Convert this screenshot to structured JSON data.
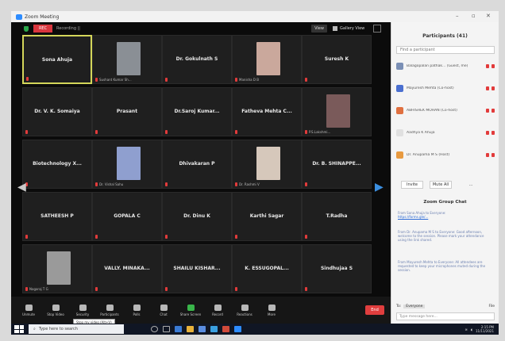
{
  "window": {
    "title": "Zoom Meeting"
  },
  "meeting_bar": {
    "rec_label": "REC",
    "recording_text": "Recording ||",
    "view_label": "View",
    "gallery_label": "Gallery View"
  },
  "tiles": [
    {
      "name": "Sona Ahuja",
      "sub": "",
      "has_photo": false,
      "active": true
    },
    {
      "name": "",
      "sub": "Sushant Kumar Sh...",
      "has_photo": true,
      "photo_color": "#8a8f95",
      "active": false
    },
    {
      "name": "Dr. Gokulnath S",
      "sub": "",
      "has_photo": false,
      "active": false
    },
    {
      "name": "",
      "sub": "Manisha D B",
      "has_photo": true,
      "photo_color": "#caa89c",
      "active": false
    },
    {
      "name": "Suresh K",
      "sub": "",
      "has_photo": false,
      "active": false
    },
    {
      "name": "Dr. V. K. Somaiya",
      "sub": "",
      "has_photo": false,
      "active": false
    },
    {
      "name": "Prasant",
      "sub": "",
      "has_photo": false,
      "active": false
    },
    {
      "name": "Dr.Saroj Kumar...",
      "sub": "",
      "has_photo": false,
      "active": false
    },
    {
      "name": "Fatheva Mehta C...",
      "sub": "",
      "has_photo": false,
      "active": false
    },
    {
      "name": "",
      "sub": "P.S.Lakshmi...",
      "has_photo": true,
      "photo_color": "#7a5a5a",
      "active": false
    },
    {
      "name": "Biotechnology X...",
      "sub": "",
      "has_photo": false,
      "active": false
    },
    {
      "name": "",
      "sub": "Dr. Vishal Sahu",
      "has_photo": true,
      "photo_color": "#8f9fcf",
      "active": false
    },
    {
      "name": "Dhivakaran P",
      "sub": "",
      "has_photo": false,
      "active": false
    },
    {
      "name": "",
      "sub": "Dr. Rashmi V",
      "has_photo": true,
      "photo_color": "#d6c8bb",
      "active": false
    },
    {
      "name": "Dr. B. SHINAPPE...",
      "sub": "",
      "has_photo": false,
      "active": false
    },
    {
      "name": "SATHEESH P",
      "sub": "",
      "has_photo": false,
      "active": false
    },
    {
      "name": "GOPALA C",
      "sub": "",
      "has_photo": false,
      "active": false
    },
    {
      "name": "Dr. Dinu K",
      "sub": "",
      "has_photo": false,
      "active": false
    },
    {
      "name": "Karthi Sagar",
      "sub": "",
      "has_photo": false,
      "active": false
    },
    {
      "name": "T.Radha",
      "sub": "",
      "has_photo": false,
      "active": false
    },
    {
      "name": "",
      "sub": "Nagaraj T G",
      "has_photo": true,
      "photo_color": "#9a9a9a",
      "active": false
    },
    {
      "name": "VALLY. MINAKA...",
      "sub": "",
      "has_photo": false,
      "active": false
    },
    {
      "name": "SHAILU KISHAR...",
      "sub": "",
      "has_photo": false,
      "active": false
    },
    {
      "name": "K. ESSUGOPAL...",
      "sub": "",
      "has_photo": false,
      "active": false
    },
    {
      "name": "Sindhujaa S",
      "sub": "",
      "has_photo": false,
      "active": false
    }
  ],
  "toolbar": {
    "items": [
      {
        "label": "Unmute",
        "icon": "microphone-icon",
        "green": false
      },
      {
        "label": "Stop Video",
        "icon": "video-camera-icon",
        "green": false
      },
      {
        "label": "Security",
        "icon": "shield-icon",
        "green": false
      },
      {
        "label": "Participants",
        "icon": "participants-icon",
        "green": false
      },
      {
        "label": "Polls",
        "icon": "poll-icon",
        "green": false
      },
      {
        "label": "Chat",
        "icon": "chat-icon",
        "green": false
      },
      {
        "label": "Share Screen",
        "icon": "share-screen-icon",
        "green": true
      },
      {
        "label": "Record",
        "icon": "record-icon",
        "green": false
      },
      {
        "label": "Reactions",
        "icon": "reactions-icon",
        "green": false
      },
      {
        "label": "More",
        "icon": "more-icon",
        "green": false
      }
    ],
    "end_label": "End",
    "tooltip": "Stop my video (Alt+V)"
  },
  "sidebar": {
    "title": "Participants (41)",
    "search_placeholder": "Find a participant",
    "participants": [
      {
        "name": "Balagopalan pathak... (Guest, me)",
        "color": "#7a8fb5"
      },
      {
        "name": "Mayuresh Mehta (Co-host)",
        "color": "#4a6fd0"
      },
      {
        "name": "ABHISHEK MOHAN (Co-host)",
        "color": "#e07040"
      },
      {
        "name": "Aadhya K Ahuja",
        "color": "#e0e0e0"
      },
      {
        "name": "Dr. Anupama M S (Host)",
        "color": "#e89a40"
      }
    ],
    "invite_label": "Invite",
    "mute_label": "Mute All",
    "more_label": "...",
    "chat_title": "Zoom Group Chat",
    "chat_messages": [
      {
        "text": "From Sona Ahuja to Everyone:",
        "link": "https://forms.gle/..."
      },
      {
        "text": "From Dr. Anupama M S to Everyone: Good afternoon, welcome to the session. Please mark your attendance using the link shared.",
        "link": ""
      },
      {
        "text": "From Mayuresh Mehta to Everyone: All attendees are requested to keep your microphones muted during the session.",
        "link": ""
      }
    ],
    "to_label": "To:",
    "to_value": "Everyone",
    "file_label": "File",
    "chat_placeholder": "Type message here..."
  },
  "taskbar": {
    "search_placeholder": "Type here to search",
    "time": "2:15 PM",
    "date": "11/11/2021"
  }
}
